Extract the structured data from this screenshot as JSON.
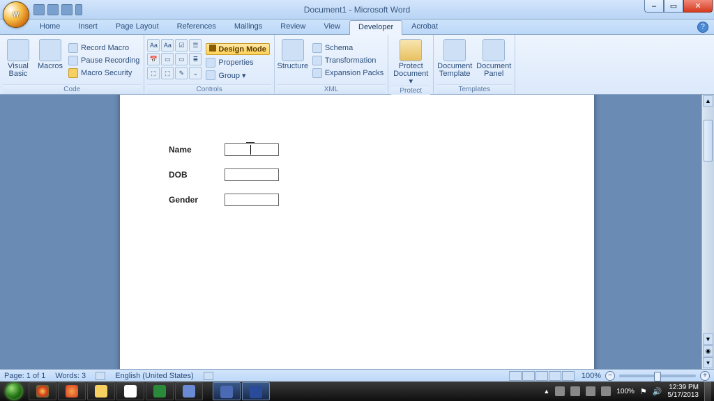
{
  "titlebar": {
    "title": "Document1 - Microsoft Word"
  },
  "tabs": [
    "Home",
    "Insert",
    "Page Layout",
    "References",
    "Mailings",
    "Review",
    "View",
    "Developer",
    "Acrobat"
  ],
  "active_tab": "Developer",
  "ribbon": {
    "code": {
      "label": "Code",
      "visual_basic": "Visual\nBasic",
      "macros": "Macros",
      "record_macro": "Record Macro",
      "pause_recording": "Pause Recording",
      "macro_security": "Macro Security"
    },
    "controls": {
      "label": "Controls",
      "design_mode": "Design Mode",
      "properties": "Properties",
      "group": "Group ▾"
    },
    "xml": {
      "label": "XML",
      "structure": "Structure",
      "schema": "Schema",
      "transformation": "Transformation",
      "expansion_packs": "Expansion Packs"
    },
    "protect": {
      "label": "Protect",
      "protect_document": "Protect\nDocument ▾"
    },
    "templates": {
      "label": "Templates",
      "document_template": "Document\nTemplate",
      "document_panel": "Document\nPanel"
    }
  },
  "form": {
    "rows": [
      {
        "label": "Name",
        "value": ""
      },
      {
        "label": "DOB",
        "value": ""
      },
      {
        "label": "Gender",
        "value": ""
      }
    ]
  },
  "statusbar": {
    "page": "Page: 1 of 1",
    "words": "Words: 3",
    "language": "English (United States)",
    "zoom": "100%"
  },
  "tray": {
    "zoom": "100%",
    "time": "12:39 PM",
    "date": "5/17/2013"
  }
}
